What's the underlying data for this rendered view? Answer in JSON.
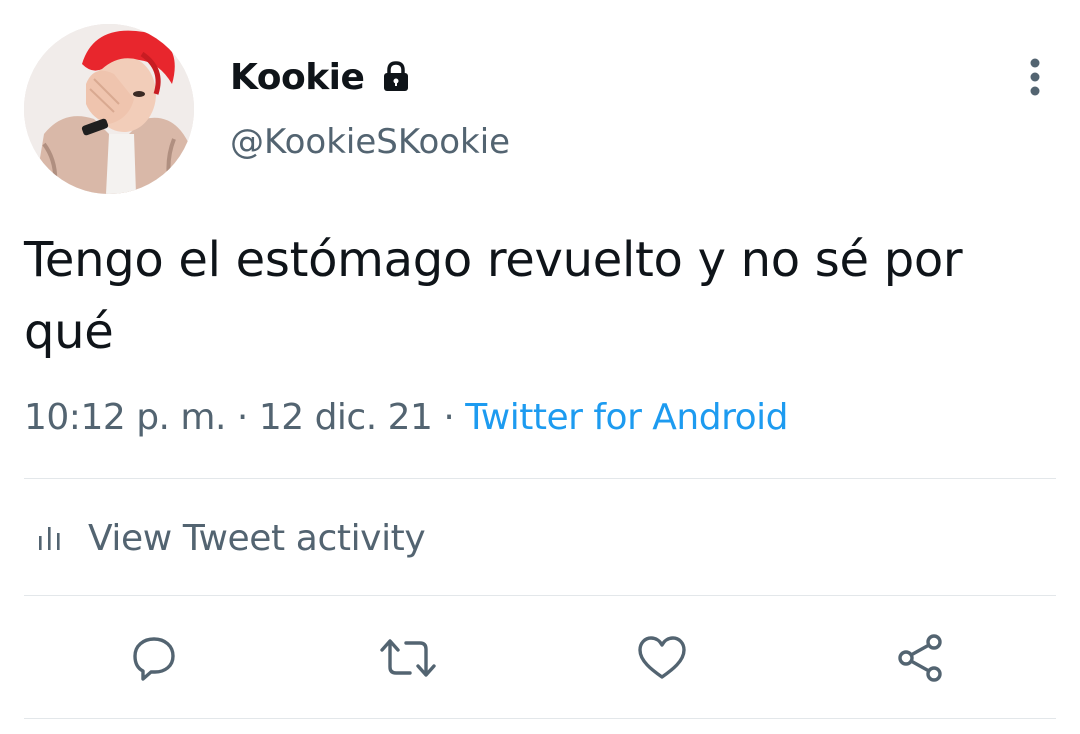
{
  "tweet": {
    "display_name": "Kookie",
    "handle": "@KookieSKookie",
    "text": "Tengo el estómago revuelto y no sé por qué",
    "time": "10:12 p. m.",
    "date": "12 dic. 21",
    "separator": "·",
    "source": "Twitter for Android",
    "protected_icon": "lock-icon",
    "avatar_description_icon": "avatar"
  },
  "activity": {
    "label": "View Tweet activity",
    "icon": "bar-chart-icon"
  },
  "actions": {
    "reply_icon": "reply-icon",
    "retweet_icon": "retweet-icon",
    "like_icon": "heart-icon",
    "share_icon": "share-icon",
    "more_icon": "more-vertical-icon"
  },
  "colors": {
    "text": "#0f1419",
    "secondary": "#536471",
    "link": "#1d9bf0",
    "divider": "#e3e7ea",
    "avatar_hair": "#e8262d"
  }
}
